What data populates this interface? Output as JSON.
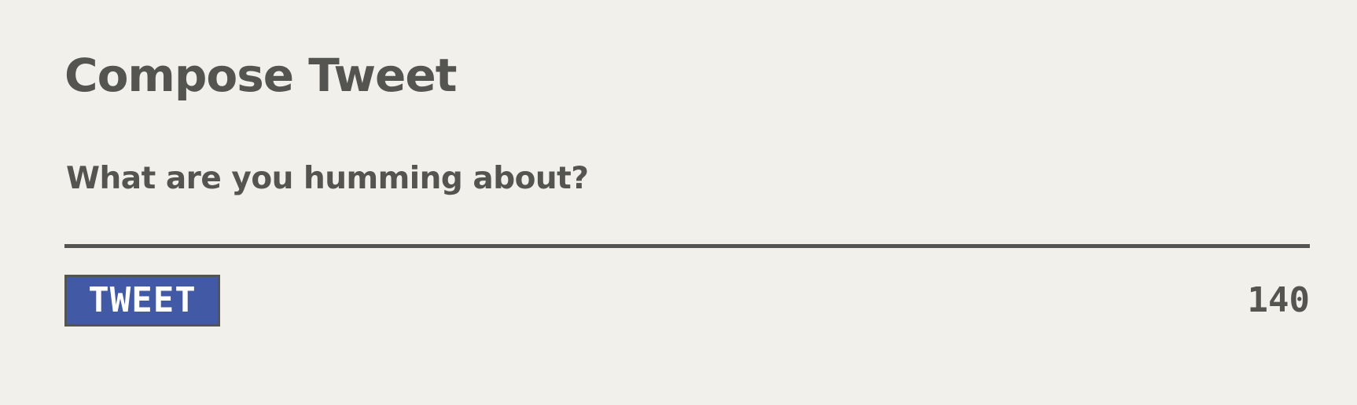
{
  "compose": {
    "title": "Compose Tweet",
    "prompt": "What are you humming about?",
    "input_value": "",
    "tweet_button_label": "TWEET",
    "char_count": "140"
  },
  "colors": {
    "background": "#f2f0eb",
    "text": "#545450",
    "button_bg": "#4259a6",
    "button_text": "#ffffff"
  }
}
